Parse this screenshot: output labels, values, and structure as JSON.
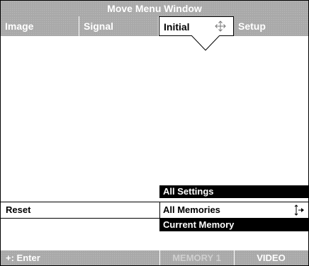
{
  "window": {
    "title": "Move Menu Window"
  },
  "tabs": [
    {
      "label": "Image",
      "active": false
    },
    {
      "label": "Signal",
      "active": false
    },
    {
      "label": "Initial",
      "active": true,
      "icon": "move-arrows-icon"
    },
    {
      "label": "Setup",
      "active": false
    }
  ],
  "reset": {
    "label": "Reset",
    "options": [
      {
        "label": "All Settings",
        "selected": false
      },
      {
        "label": "All Memories",
        "selected": true,
        "icon": "up-down-arrow-icon"
      },
      {
        "label": "Current Memory",
        "selected": false
      }
    ]
  },
  "footer": {
    "hint": "+: Enter",
    "memory": "MEMORY 1",
    "source": "VIDEO"
  },
  "colors": {
    "bar": "#a9a9a9",
    "highlight": "#000000",
    "background": "#ffffff"
  }
}
